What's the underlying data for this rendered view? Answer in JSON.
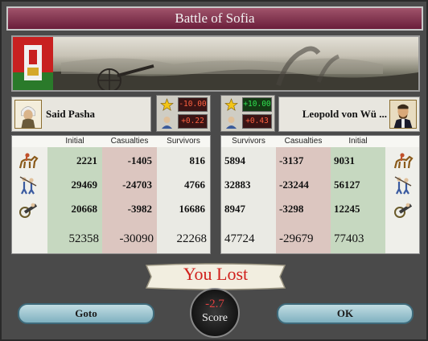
{
  "window": {
    "title": "Battle of Sofia"
  },
  "attacker": {
    "commander": "Said Pasha",
    "modifiers": {
      "general": "-10.00",
      "morale": "+0.22"
    }
  },
  "defender": {
    "commander": "Leopold von Wü ...",
    "modifiers": {
      "general": "+10.00",
      "morale": "+0.43"
    }
  },
  "left_headers": {
    "initial": "Initial",
    "casualties": "Casualties",
    "survivors": "Survivors"
  },
  "right_headers": {
    "survivors": "Survivors",
    "casualties": "Casualties",
    "initial": "Initial"
  },
  "left_rows": [
    {
      "unit": "cavalry",
      "initial": "2221",
      "casualties": "-1405",
      "survivors": "816"
    },
    {
      "unit": "infantry",
      "initial": "29469",
      "casualties": "-24703",
      "survivors": "4766"
    },
    {
      "unit": "artillery",
      "initial": "20668",
      "casualties": "-3982",
      "survivors": "16686"
    }
  ],
  "left_totals": {
    "initial": "52358",
    "casualties": "-30090",
    "survivors": "22268"
  },
  "right_rows": [
    {
      "unit": "cavalry",
      "survivors": "5894",
      "casualties": "-3137",
      "initial": "9031"
    },
    {
      "unit": "infantry",
      "survivors": "32883",
      "casualties": "-23244",
      "initial": "56127"
    },
    {
      "unit": "artillery",
      "survivors": "8947",
      "casualties": "-3298",
      "initial": "12245"
    }
  ],
  "right_totals": {
    "survivors": "47724",
    "casualties": "-29679",
    "initial": "77403"
  },
  "result": {
    "text": "You Lost"
  },
  "score": {
    "value": "-2.7",
    "label": "Score"
  },
  "buttons": {
    "goto": "Goto",
    "ok": "OK"
  },
  "colors": {
    "title_bar": "#7d2a48",
    "lost": "#d0201c",
    "negative": "#ff6040",
    "positive": "#30e050",
    "button": "#9ec8d2"
  },
  "icons": [
    "star-icon",
    "morale-icon",
    "cavalry-icon",
    "infantry-icon",
    "artillery-icon",
    "ottoman-flag-icon",
    "austria-flag-icon"
  ]
}
